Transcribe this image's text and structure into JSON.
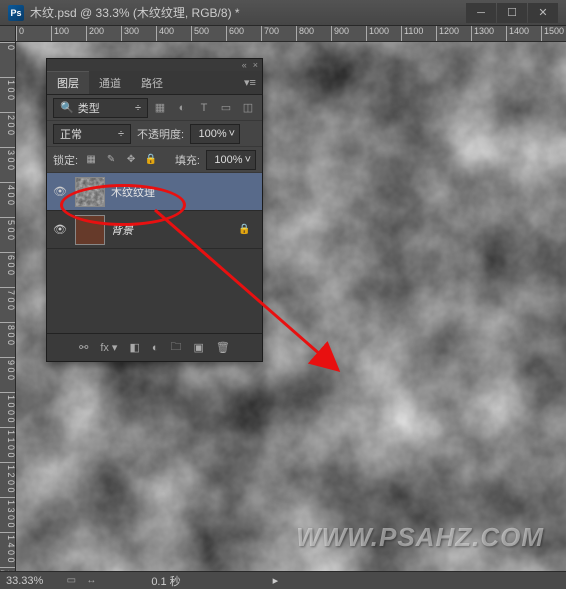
{
  "titlebar": {
    "app_icon_text": "Ps",
    "title": "木纹.psd @ 33.3% (木纹纹理, RGB/8) *"
  },
  "ruler": {
    "h": [
      "0",
      "100",
      "200",
      "300",
      "400",
      "500",
      "600",
      "700",
      "800",
      "900",
      "1000",
      "1100",
      "1200",
      "1300",
      "1400",
      "1500"
    ],
    "v": [
      "0",
      "1 0 0",
      "2 0 0",
      "3 0 0",
      "4 0 0",
      "5 0 0",
      "6 0 0",
      "7 0 0",
      "8 0 0",
      "9 0 0",
      "1 0 0 0",
      "1 1 0 0",
      "1 2 0 0",
      "1 3 0 0",
      "1 4 0 0",
      "1 5 0 0"
    ]
  },
  "panel": {
    "tabs": {
      "layers": "图层",
      "channels": "通道",
      "paths": "路径"
    },
    "filter": {
      "search_icon": "🔍",
      "type_label": "类型",
      "dropdown_icon": "÷"
    },
    "blend": {
      "mode": "正常",
      "opacity_label": "不透明度:",
      "opacity_value": "100%"
    },
    "lock": {
      "label": "锁定:",
      "fill_label": "填充:",
      "fill_value": "100%"
    },
    "layers": [
      {
        "name": "木纹纹理",
        "visible": true,
        "selected": true,
        "thumb": "noise",
        "locked": false
      },
      {
        "name": "背景",
        "visible": true,
        "selected": false,
        "thumb": "brown",
        "locked": true,
        "italic": true
      }
    ]
  },
  "statusbar": {
    "zoom": "33.33%",
    "time": "0.1 秒"
  },
  "watermark": "WWW.PSAHZ.COM"
}
